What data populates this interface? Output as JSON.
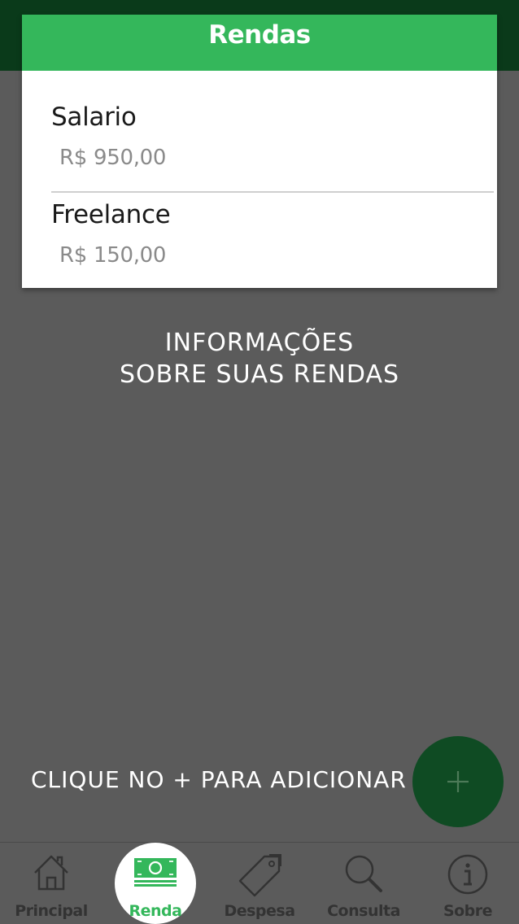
{
  "dialog": {
    "title": "Rendas",
    "items": [
      {
        "name": "Salario",
        "value": "R$ 950,00"
      },
      {
        "name": "Freelance",
        "value": "R$ 150,00"
      }
    ]
  },
  "info": {
    "line1": "INFORMAÇÕES",
    "line2": "SOBRE SUAS RENDAS"
  },
  "hint": "CLIQUE NO + PARA ADICIONAR",
  "fab": {
    "icon": "plus-icon"
  },
  "nav": {
    "active": "Renda",
    "items": [
      {
        "label": "Principal",
        "icon": "home-icon"
      },
      {
        "label": "Renda",
        "icon": "money-icon"
      },
      {
        "label": "Despesa",
        "icon": "price-tag-icon"
      },
      {
        "label": "Consulta",
        "icon": "search-icon"
      },
      {
        "label": "Sobre",
        "icon": "info-icon"
      }
    ]
  },
  "colors": {
    "brand_green": "#34b75b",
    "dark_green": "#0f4b23",
    "overlay_gray": "#5b5b5b"
  }
}
